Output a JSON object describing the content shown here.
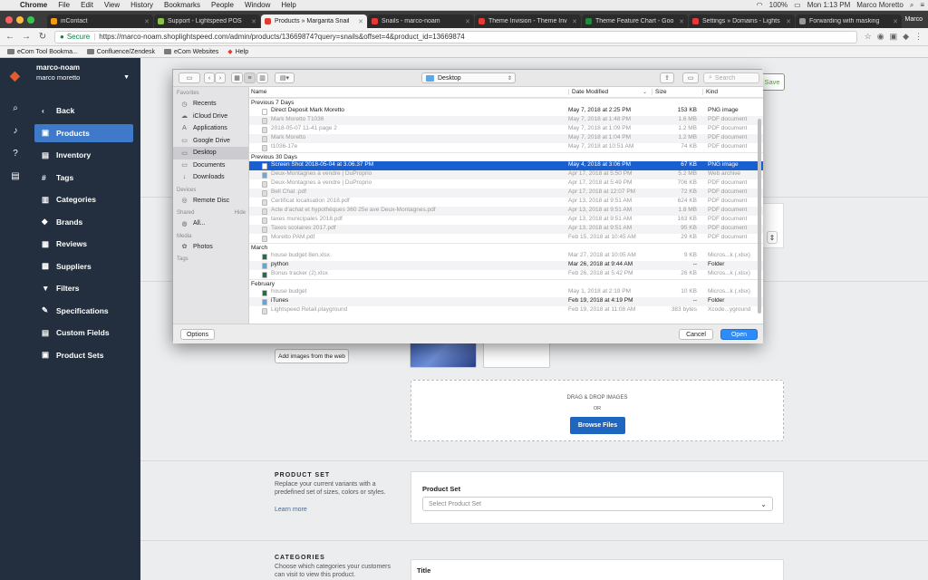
{
  "menubar": {
    "app": "Chrome",
    "items": [
      "File",
      "Edit",
      "View",
      "History",
      "Bookmarks",
      "People",
      "Window",
      "Help"
    ],
    "battery": "100%",
    "clock": "Mon 1:13 PM",
    "user": "Marco Moretto"
  },
  "tabs": [
    {
      "label": "inContact",
      "color": "#f39c12"
    },
    {
      "label": "Support - Lightspeed POS",
      "color": "#8bc34a"
    },
    {
      "label": "Products » Margarita Snail",
      "color": "#e53935",
      "active": true
    },
    {
      "label": "Snails - marco-noam",
      "color": "#e53935"
    },
    {
      "label": "Theme Invision - Theme Inv",
      "color": "#e53935"
    },
    {
      "label": "Theme Feature Chart - Goo",
      "color": "#1e8e3e"
    },
    {
      "label": "Settings » Domains - Lights",
      "color": "#e53935"
    },
    {
      "label": "Forwarding with masking",
      "color": "#999999"
    }
  ],
  "profile_label": "Marco",
  "omnibox": {
    "secure": "Secure",
    "url": "https://marco-noam.shoplightspeed.com/admin/products/13669874?query=snails&offset=4&product_id=13669874"
  },
  "bookmarks": [
    "eCom Tool Bookma...",
    "Confluence/Zendesk",
    "eCom Websites",
    "Help"
  ],
  "sidebar": {
    "account_name": "marco-noam",
    "account_user": "marco moretto",
    "items": [
      {
        "label": "Back",
        "icon": "‹"
      },
      {
        "label": "Products",
        "icon": "▣",
        "active": true
      },
      {
        "label": "Inventory",
        "icon": "▤"
      },
      {
        "label": "Tags",
        "icon": "#"
      },
      {
        "label": "Categories",
        "icon": "▥"
      },
      {
        "label": "Brands",
        "icon": "◆"
      },
      {
        "label": "Reviews",
        "icon": "▦"
      },
      {
        "label": "Suppliers",
        "icon": "▩"
      },
      {
        "label": "Filters",
        "icon": "▼"
      },
      {
        "label": "Specifications",
        "icon": "✎"
      },
      {
        "label": "Custom Fields",
        "icon": "▤"
      },
      {
        "label": "Product Sets",
        "icon": "▣"
      }
    ]
  },
  "main": {
    "save_label": "Save",
    "add_images_web": "Add images from the web",
    "drag_drop": "DRAG & DROP IMAGES",
    "or": "OR",
    "browse": "Browse Files",
    "product_set": {
      "title": "PRODUCT SET",
      "desc": "Replace your current variants with a predefined set of sizes, colors or styles.",
      "learn_more": "Learn more",
      "field_label": "Product Set",
      "placeholder": "Select Product Set"
    },
    "categories": {
      "title": "CATEGORIES",
      "desc": "Choose which categories your customers can visit to view this product.",
      "field_label": "Title"
    }
  },
  "dialog": {
    "location": "Desktop",
    "search_placeholder": "Search",
    "sidebar": [
      {
        "group": "Favorites",
        "items": [
          {
            "label": "Recents",
            "icon": "◷"
          },
          {
            "label": "iCloud Drive",
            "icon": "☁"
          },
          {
            "label": "Applications",
            "icon": "A"
          },
          {
            "label": "Google Drive",
            "icon": "▭"
          },
          {
            "label": "Desktop",
            "icon": "▭",
            "selected": true
          },
          {
            "label": "Documents",
            "icon": "▭"
          },
          {
            "label": "Downloads",
            "icon": "↓"
          }
        ]
      },
      {
        "group": "Devices",
        "items": [
          {
            "label": "Remote Disc",
            "icon": "◎"
          }
        ]
      },
      {
        "group": "Shared",
        "hide": "Hide",
        "items": [
          {
            "label": "All...",
            "icon": "◍"
          }
        ]
      },
      {
        "group": "Media",
        "items": [
          {
            "label": "Photos",
            "icon": "✿"
          }
        ]
      },
      {
        "group": "Tags",
        "items": []
      }
    ],
    "columns": {
      "name": "Name",
      "date": "Date Modified",
      "size": "Size",
      "kind": "Kind"
    },
    "groups": [
      {
        "title": "Previous 7 Days",
        "rows": [
          {
            "name": "Direct Deposit Mark Moretto",
            "date": "May 7, 2018 at 2:25 PM",
            "size": "153 KB",
            "kind": "PNG image",
            "enabled": true,
            "icon": "#ffffff"
          },
          {
            "name": "Mark Moretto T1036",
            "date": "May 7, 2018 at 1:48 PM",
            "size": "1.6 MB",
            "kind": "PDF document",
            "icon": "#dddddd"
          },
          {
            "name": "2018-05-07 11-41 page 2",
            "date": "May 7, 2018 at 1:09 PM",
            "size": "1.2 MB",
            "kind": "PDF document",
            "icon": "#dddddd"
          },
          {
            "name": "Mark Moretto",
            "date": "May 7, 2018 at 1:04 PM",
            "size": "1.2 MB",
            "kind": "PDF document",
            "icon": "#dddddd"
          },
          {
            "name": "t1036-17e",
            "date": "May 7, 2018 at 10:51 AM",
            "size": "74 KB",
            "kind": "PDF document",
            "icon": "#dddddd"
          }
        ]
      },
      {
        "title": "Previous 30 Days",
        "rows": [
          {
            "name": "Screen Shot 2018-05-04 at 3.06.37 PM",
            "date": "May 4, 2018 at 3:06 PM",
            "size": "67 KB",
            "kind": "PNG image",
            "selected": true,
            "icon": "#ffffff"
          },
          {
            "name": "Deux-Montagnes à vendre | DuProprio",
            "date": "Apr 17, 2018 at 5:50 PM",
            "size": "5.2 MB",
            "kind": "Web archive",
            "icon": "#6fa8dc"
          },
          {
            "name": "Deux-Montagnes à vendre | DuProprio",
            "date": "Apr 17, 2018 at 5:49 PM",
            "size": "706 KB",
            "kind": "PDF document",
            "icon": "#dddddd"
          },
          {
            "name": "Bell Chat .pdf",
            "date": "Apr 17, 2018 at 12:07 PM",
            "size": "72 KB",
            "kind": "PDF document",
            "icon": "#dddddd"
          },
          {
            "name": "Certificat localisation 2018.pdf",
            "date": "Apr 13, 2018 at 9:51 AM",
            "size": "624 KB",
            "kind": "PDF document",
            "icon": "#dddddd"
          },
          {
            "name": "Acte d'achat et hypothèques 360 25e ave Deux-Montagnes.pdf",
            "date": "Apr 13, 2018 at 9:51 AM",
            "size": "1.8 MB",
            "kind": "PDF document",
            "icon": "#dddddd"
          },
          {
            "name": "taxes municipales 2018.pdf",
            "date": "Apr 13, 2018 at 9:51 AM",
            "size": "163 KB",
            "kind": "PDF document",
            "icon": "#dddddd"
          },
          {
            "name": "Taxes scolaires 2017.pdf",
            "date": "Apr 13, 2018 at 9:51 AM",
            "size": "95 KB",
            "kind": "PDF document",
            "icon": "#dddddd"
          },
          {
            "name": "Moretto PAM.pdf",
            "date": "Feb 15, 2018 at 10:45 AM",
            "size": "29 KB",
            "kind": "PDF document",
            "icon": "#dddddd"
          }
        ]
      },
      {
        "title": "March",
        "rows": [
          {
            "name": "house budget 8en.xlsx",
            "date": "Mar 27, 2018 at 10:05 AM",
            "size": "9 KB",
            "kind": "Micros...k (.xlsx)",
            "icon": "#1e7145"
          },
          {
            "name": "python",
            "date": "Mar 26, 2018 at 9:44 AM",
            "size": "--",
            "kind": "Folder",
            "enabled": true,
            "icon": "#5ba7e8"
          },
          {
            "name": "Bonus tracker (2).xlsx",
            "date": "Feb 26, 2018 at 5:42 PM",
            "size": "26 KB",
            "kind": "Micros...k (.xlsx)",
            "icon": "#1e7145"
          }
        ]
      },
      {
        "title": "February",
        "rows": [
          {
            "name": "house budget",
            "date": "May 1, 2018 at 2:19 PM",
            "size": "10 KB",
            "kind": "Micros...k (.xlsx)",
            "icon": "#1e7145"
          },
          {
            "name": "iTunes",
            "date": "Feb 19, 2018 at 4:19 PM",
            "size": "--",
            "kind": "Folder",
            "enabled": true,
            "icon": "#5ba7e8"
          },
          {
            "name": "Lightspeed Retail.playground",
            "date": "Feb 19, 2018 at 11:08 AM",
            "size": "383 bytes",
            "kind": "Xcode...yground",
            "icon": "#dddddd"
          }
        ]
      }
    ],
    "options": "Options",
    "cancel": "Cancel",
    "open": "Open"
  }
}
